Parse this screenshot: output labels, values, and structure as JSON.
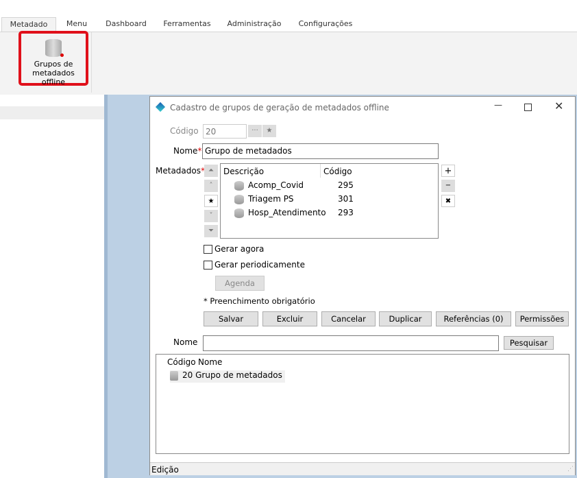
{
  "tabs": [
    "Metadado",
    "Menu",
    "Dashboard",
    "Ferramentas",
    "Administração",
    "Configurações"
  ],
  "ribbon": {
    "button_label_1": "Grupos de",
    "button_label_2": "metadados offline"
  },
  "dialog": {
    "title": "Cadastro de grupos de geração de metadados offline",
    "codigo_label": "Código",
    "codigo_value": "20",
    "nome_label": "Nome",
    "nome_value": "Grupo de metadados",
    "metadados_label": "Metadados",
    "grid_headers": [
      "Descrição",
      "Código"
    ],
    "metadados": [
      {
        "desc": "Acomp_Covid",
        "code": "295"
      },
      {
        "desc": "Triagem PS",
        "code": "301"
      },
      {
        "desc": "Hosp_Atendimento",
        "code": "293"
      }
    ],
    "gerar_agora": "Gerar agora",
    "gerar_periodicamente": "Gerar periodicamente",
    "agenda": "Agenda",
    "obrigatorio": "* Preenchimento obrigatório",
    "buttons": [
      "Salvar",
      "Excluir",
      "Cancelar",
      "Duplicar",
      "Referências (0)",
      "Permissões"
    ],
    "search_label": "Nome",
    "search_value": "",
    "search_button": "Pesquisar",
    "results_headers": [
      "Código",
      "Nome"
    ],
    "results": [
      {
        "code": "20",
        "name": "Grupo de metadados"
      }
    ],
    "status": "Edição"
  }
}
